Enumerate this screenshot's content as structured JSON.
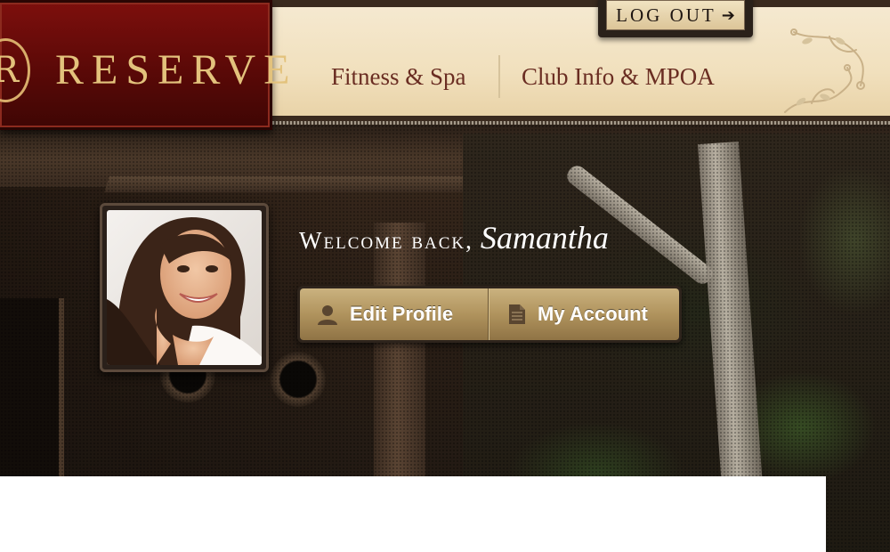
{
  "brand": {
    "mark": "R",
    "name": "RESERVE"
  },
  "nav": {
    "items": [
      {
        "label": "Fitness & Spa"
      },
      {
        "label": "Club Info & MPOA"
      }
    ]
  },
  "logout": {
    "label": "LOG OUT",
    "icon": "arrow-right-icon",
    "arrow": "➔"
  },
  "welcome": {
    "greeting": "Welcome back,",
    "user_name": "Samantha"
  },
  "actions": {
    "edit_profile": {
      "label": "Edit Profile",
      "icon": "person-icon"
    },
    "my_account": {
      "label": "My Account",
      "icon": "document-icon"
    }
  },
  "colors": {
    "brand_red": "#6b0c0a",
    "brand_gold": "#e3c27c",
    "nav_text": "#6a2d22",
    "button_gold": "#b0935d"
  }
}
